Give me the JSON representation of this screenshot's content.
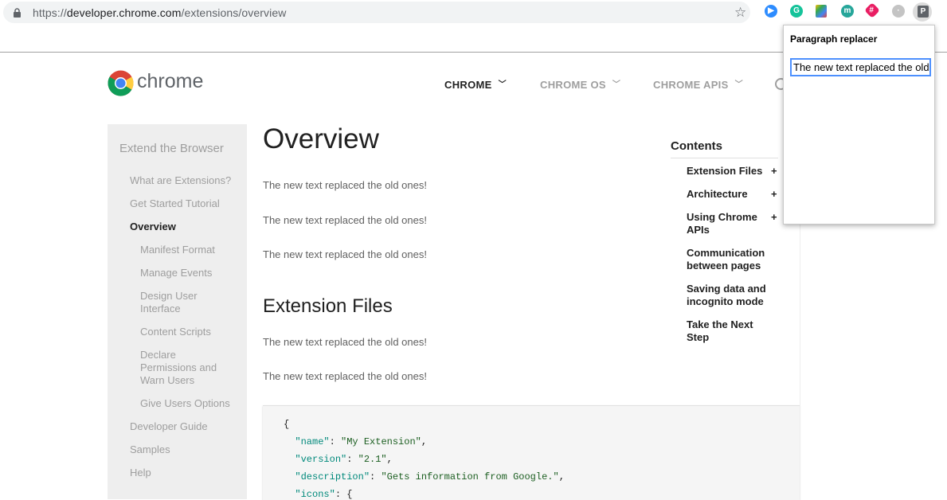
{
  "browser": {
    "url_scheme": "https://",
    "url_host": "developer.chrome.com",
    "url_path": "/extensions/overview",
    "extensions": [
      {
        "name": "zoom-extension-icon",
        "color": "#2d8cff",
        "glyph": "▶"
      },
      {
        "name": "grammarly-extension-icon",
        "color": "#15c39a",
        "glyph": "G"
      },
      {
        "name": "docs-extension-icon",
        "color": "#f4b400",
        "glyph": ""
      },
      {
        "name": "m-extension-icon",
        "color": "#26a69a",
        "glyph": "m"
      },
      {
        "name": "hash-extension-icon",
        "color": "#e91e63",
        "glyph": "#"
      },
      {
        "name": "stats-extension-icon",
        "color": "#9e9e9e",
        "glyph": "·"
      }
    ],
    "active_extension_label": "P"
  },
  "site": {
    "logo_text": "chrome",
    "nav": [
      {
        "label": "CHROME",
        "active": true
      },
      {
        "label": "CHROME OS",
        "active": false
      },
      {
        "label": "CHROME APIS",
        "active": false
      }
    ]
  },
  "leftnav": {
    "section": "Extend the Browser",
    "items": [
      {
        "label": "What are Extensions?"
      },
      {
        "label": "Get Started Tutorial"
      },
      {
        "label": "Overview"
      },
      {
        "label": "Manifest Format"
      },
      {
        "label": "Manage Events"
      },
      {
        "label": "Design User Interface"
      },
      {
        "label": "Content Scripts"
      },
      {
        "label": "Declare Permissions and Warn Users"
      },
      {
        "label": "Give Users Options"
      },
      {
        "label": "Developer Guide"
      },
      {
        "label": "Samples"
      },
      {
        "label": "Help"
      }
    ]
  },
  "main": {
    "title": "Overview",
    "paragraphs": [
      "The new text replaced the old ones!",
      "The new text replaced the old ones!",
      "The new text replaced the old ones!"
    ],
    "section_heading": "Extension Files",
    "section_paragraphs": [
      "The new text replaced the old ones!",
      "The new text replaced the old ones!"
    ],
    "code": {
      "open": "{",
      "name_key": "\"name\"",
      "name_val": "\"My Extension\"",
      "version_key": "\"version\"",
      "version_val": "\"2.1\"",
      "desc_key": "\"description\"",
      "desc_val": "\"Gets information from Google.\"",
      "icons_key": "\"icons\"",
      "icons_open": "{"
    }
  },
  "toc": {
    "title": "Contents",
    "items": [
      {
        "label": "Extension Files",
        "expand": "+"
      },
      {
        "label": "Architecture",
        "expand": "+"
      },
      {
        "label": "Using Chrome APIs",
        "expand": "+"
      },
      {
        "label": "Communication between pages",
        "expand": ""
      },
      {
        "label": "Saving data and incognito mode",
        "expand": ""
      },
      {
        "label": "Take the Next Step",
        "expand": ""
      }
    ]
  },
  "popup": {
    "title": "Paragraph replacer",
    "input_value": "The new text replaced the old ones!"
  }
}
